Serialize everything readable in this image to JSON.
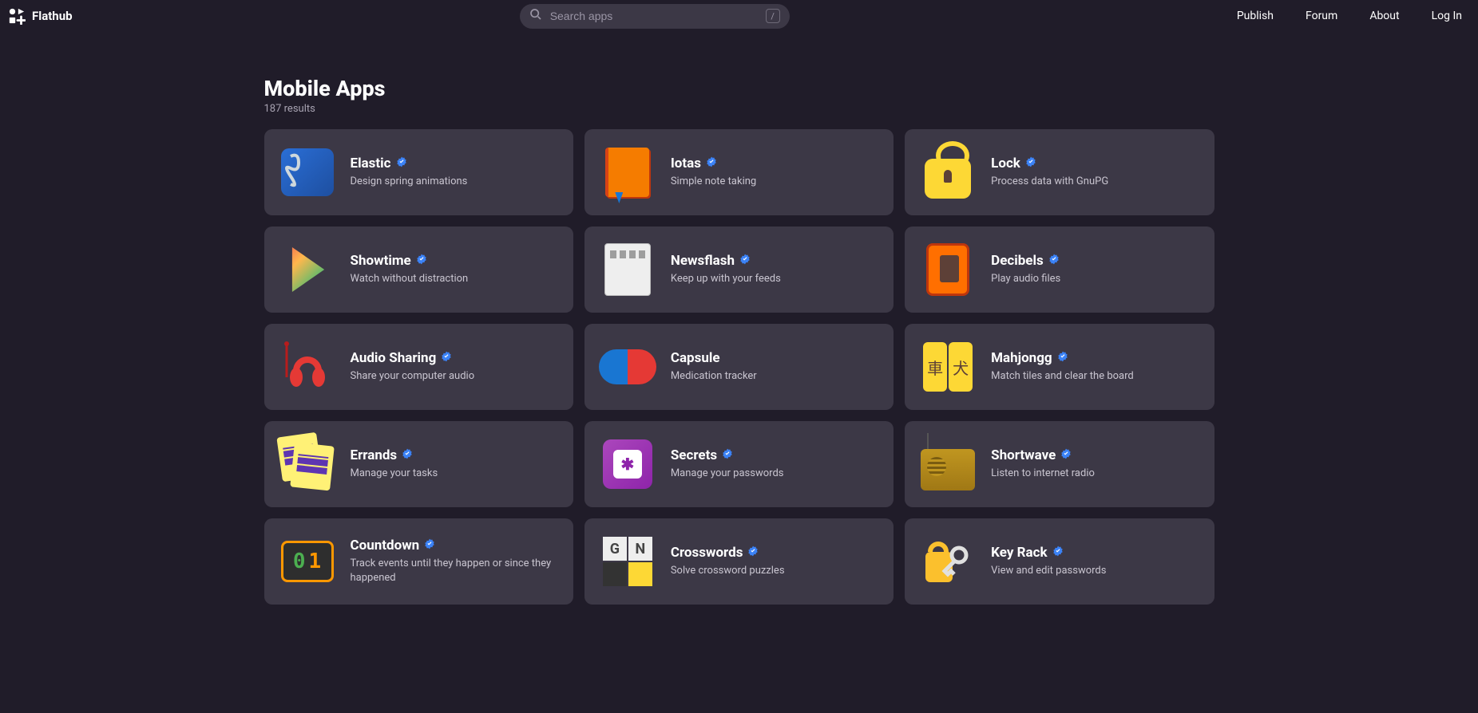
{
  "header": {
    "brand": "Flathub",
    "search_placeholder": "Search apps",
    "shortcut": "/",
    "nav": {
      "publish": "Publish",
      "forum": "Forum",
      "about": "About",
      "login": "Log In"
    }
  },
  "page": {
    "title": "Mobile Apps",
    "results": "187 results"
  },
  "apps": [
    {
      "name": "Elastic",
      "desc": "Design spring animations",
      "verified": true,
      "icon": "elastic"
    },
    {
      "name": "Iotas",
      "desc": "Simple note taking",
      "verified": true,
      "icon": "iotas"
    },
    {
      "name": "Lock",
      "desc": "Process data with GnuPG",
      "verified": true,
      "icon": "lock"
    },
    {
      "name": "Showtime",
      "desc": "Watch without distraction",
      "verified": true,
      "icon": "showtime"
    },
    {
      "name": "Newsflash",
      "desc": "Keep up with your feeds",
      "verified": true,
      "icon": "newsflash"
    },
    {
      "name": "Decibels",
      "desc": "Play audio files",
      "verified": true,
      "icon": "decibels"
    },
    {
      "name": "Audio Sharing",
      "desc": "Share your computer audio",
      "verified": true,
      "icon": "audio-sharing"
    },
    {
      "name": "Capsule",
      "desc": "Medication tracker",
      "verified": false,
      "icon": "capsule"
    },
    {
      "name": "Mahjongg",
      "desc": "Match tiles and clear the board",
      "verified": true,
      "icon": "mahjongg"
    },
    {
      "name": "Errands",
      "desc": "Manage your tasks",
      "verified": true,
      "icon": "errands"
    },
    {
      "name": "Secrets",
      "desc": "Manage your passwords",
      "verified": true,
      "icon": "secrets"
    },
    {
      "name": "Shortwave",
      "desc": "Listen to internet radio",
      "verified": true,
      "icon": "shortwave"
    },
    {
      "name": "Countdown",
      "desc": "Track events until they happen or since they happened",
      "verified": true,
      "icon": "countdown"
    },
    {
      "name": "Crosswords",
      "desc": "Solve crossword puzzles",
      "verified": true,
      "icon": "crosswords"
    },
    {
      "name": "Key Rack",
      "desc": "View and edit passwords",
      "verified": true,
      "icon": "keyrack"
    }
  ]
}
